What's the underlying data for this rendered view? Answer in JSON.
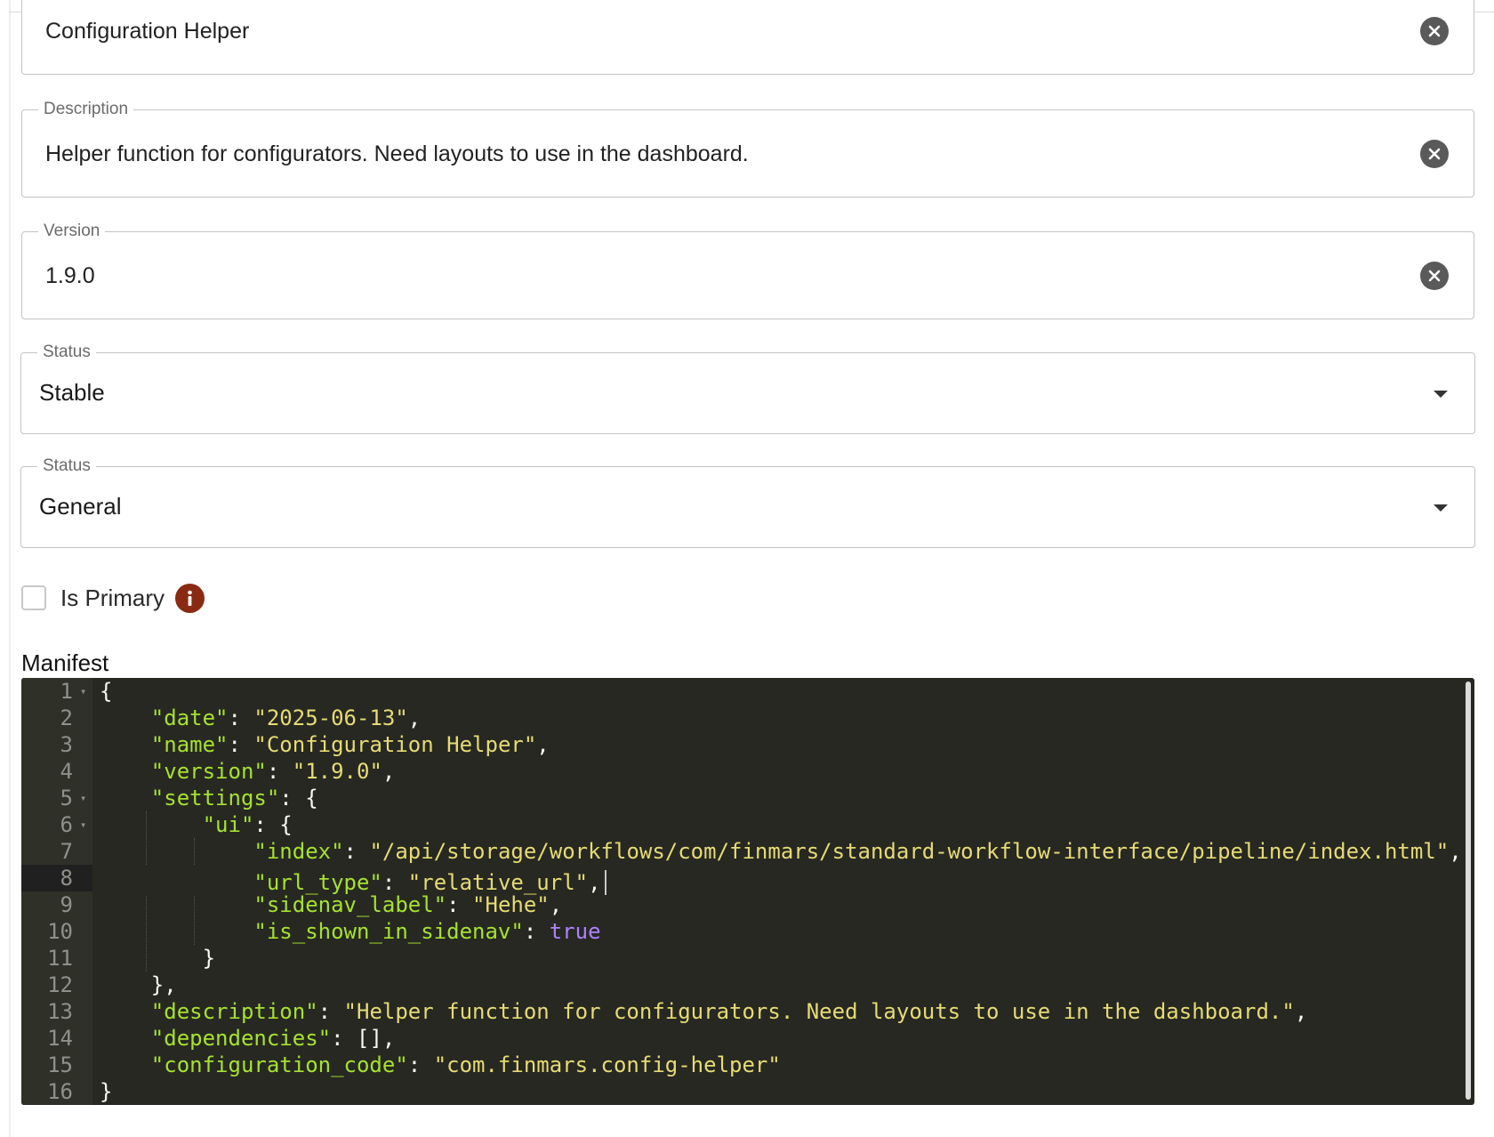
{
  "form": {
    "name": {
      "value": "Configuration Helper"
    },
    "description": {
      "label": "Description",
      "value": "Helper function for configurators. Need layouts to use in the dashboard."
    },
    "version": {
      "label": "Version",
      "value": "1.9.0"
    },
    "status_1": {
      "label": "Status",
      "value": "Stable"
    },
    "status_2": {
      "label": "Status",
      "value": "General"
    },
    "is_primary": {
      "label": "Is Primary",
      "checked": false,
      "info_icon": "info-icon"
    },
    "manifest": {
      "label": "Manifest"
    }
  },
  "editor": {
    "line_numbers": [
      "1",
      "2",
      "3",
      "4",
      "5",
      "6",
      "7",
      "8",
      "9",
      "10",
      "11",
      "12",
      "13",
      "14",
      "15",
      "16"
    ],
    "code": {
      "l1_open": "{",
      "date_key": "\"date\"",
      "date_val": "\"2025-06-13\"",
      "name_key": "\"name\"",
      "name_val": "\"Configuration Helper\"",
      "version_key": "\"version\"",
      "version_val": "\"1.9.0\"",
      "settings_key": "\"settings\"",
      "ui_key": "\"ui\"",
      "index_key": "\"index\"",
      "index_val": "\"/api/storage/workflows/com/finmars/standard-workflow-interface/pipeline/index.html\"",
      "url_type_key": "\"url_type\"",
      "url_type_val": "\"relative_url\"",
      "sidenav_label_key": "\"sidenav_label\"",
      "sidenav_label_val": "\"Hehe\"",
      "is_shown_key": "\"is_shown_in_sidenav\"",
      "is_shown_val": "true",
      "description_key": "\"description\"",
      "description_val": "\"Helper function for configurators. Need layouts to use in the dashboard.\"",
      "dependencies_key": "\"dependencies\"",
      "dependencies_val": "[]",
      "config_code_key": "\"configuration_code\"",
      "config_code_val": "\"com.finmars.config-helper\"",
      "l16_close": "}"
    }
  },
  "colors": {
    "editor_bg": "#272822",
    "key": "#a6e22e",
    "string": "#e6db74",
    "boolean": "#ae81ff",
    "info_icon": "#8a2a12"
  }
}
